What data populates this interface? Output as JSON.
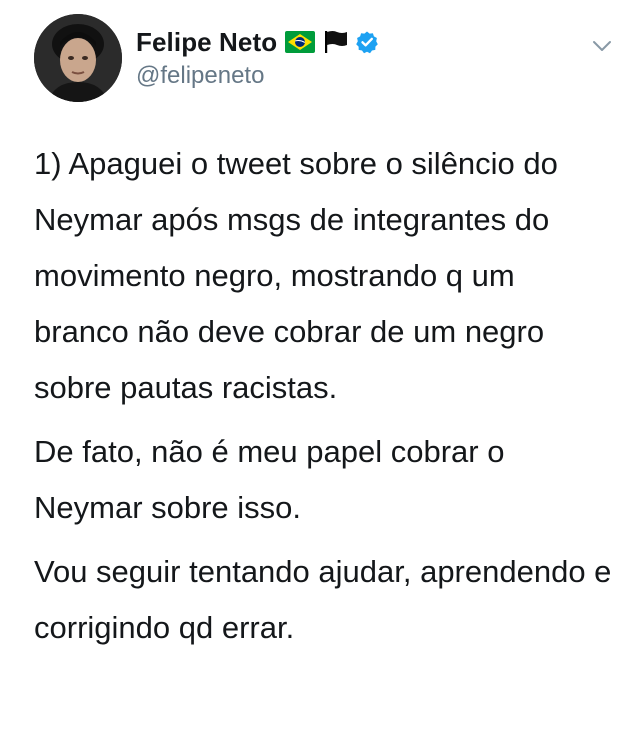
{
  "user": {
    "display_name": "Felipe Neto",
    "handle": "@felipeneto",
    "flag_icon": "brazil-flag-icon",
    "secondary_flag_icon": "black-flag-icon",
    "verified_icon": "verified-badge-icon",
    "menu_icon": "chevron-down-icon"
  },
  "tweet": {
    "paragraph_1": "1) Apaguei o tweet sobre o silêncio do Neymar após msgs de integrantes do movimento negro, mostrando q um branco não deve cobrar de um negro sobre pautas racistas.",
    "paragraph_2": "De fato, não é meu papel cobrar o Neymar sobre isso.",
    "paragraph_3": "Vou seguir tentando ajudar, aprendendo e corrigindo qd errar."
  },
  "colors": {
    "text_primary": "#14171a",
    "text_secondary": "#657786",
    "verified_blue": "#1da1f2",
    "brazil_green": "#009c3b",
    "brazil_yellow": "#ffdf00",
    "brazil_blue": "#002776"
  }
}
